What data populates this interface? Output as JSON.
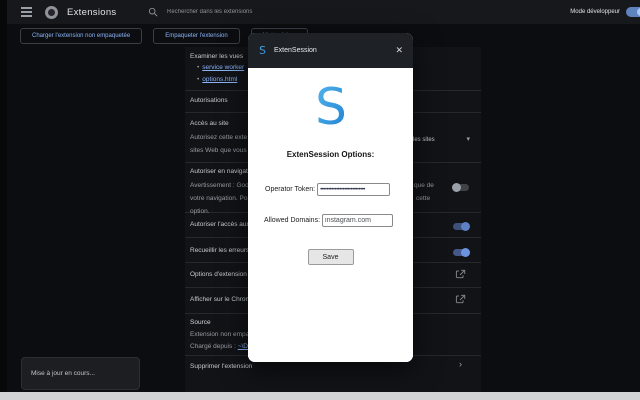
{
  "header": {
    "title": "Extensions",
    "search_placeholder": "Rechercher dans les extensions",
    "dev_mode_label": "Mode développeur"
  },
  "toolbar": {
    "load_unpacked": "Charger l'extension non empaquetée",
    "pack": "Empaqueter l'extension",
    "update": "Mettre à jour"
  },
  "details": {
    "inspect_views_label": "Examiner les vues",
    "link_service_worker": "service worker",
    "link_options_html": "options.html",
    "permissions_label": "Autorisations",
    "site_access_label": "Accès au site",
    "site_access_line1": "Autorisez cette exte",
    "site_access_line2": "sites Web que vous c",
    "site_access_value": "les sites",
    "incognito_label": "Autoriser en navigati",
    "incognito_warn1": "Avertissement : Goo",
    "incognito_warn2": "votre navigation. Po",
    "incognito_warn3": "option.",
    "incognito_frag1": "que de",
    "incognito_frag2": "cette",
    "file_urls_label": "Autoriser l'accès aux",
    "collect_errors_label": "Recueillir les erreurs",
    "options_label": "Options d'extension",
    "store_label": "Afficher sur le Chrom",
    "source_label": "Source",
    "source_type": "Extension non empa",
    "loaded_from_prefix": "Chargé depuis : ",
    "loaded_from_link": "~\\D",
    "remove_label": "Supprimer l'extension"
  },
  "dialog": {
    "title": "ExtenSession",
    "heading": "ExtenSession Options:",
    "token_label": "Operator Token:",
    "token_value": "••••••••••••••••••••••••••••",
    "domains_label": "Allowed Domains:",
    "domains_value": "instagram.com",
    "save_label": "Save"
  },
  "brand": {
    "logo_letter": "S"
  },
  "icons": {
    "close": "✕",
    "dropdown_arrow": "▾",
    "chevron": "›"
  },
  "toast": {
    "message": "Mise à jour en cours..."
  },
  "colors": {
    "accent_blue": "#8ab4f8",
    "logo_blue_top": "#55b8ee",
    "logo_blue_bottom": "#1e7fd0",
    "dialog_header": "#1e2226"
  }
}
